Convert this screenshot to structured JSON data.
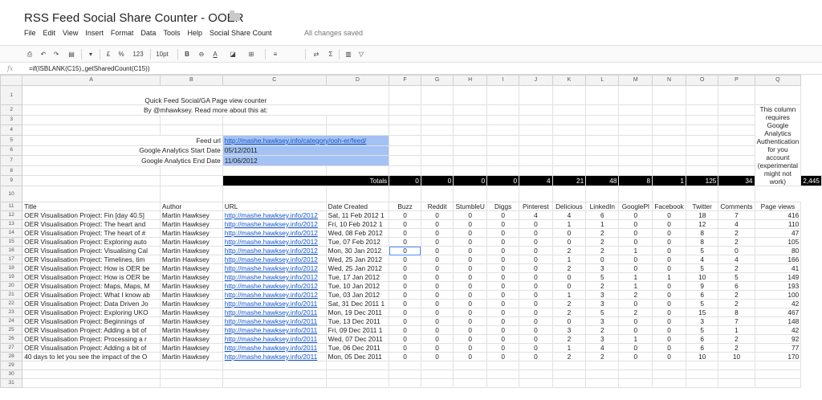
{
  "app": {
    "title": "RSS Feed Social Share Counter - OOER",
    "save_status": "All changes saved",
    "menu": [
      "File",
      "Edit",
      "View",
      "Insert",
      "Format",
      "Data",
      "Tools",
      "Help",
      "Social Share Count"
    ]
  },
  "toolbar": {
    "zoom_label": "%",
    "number_format": "123",
    "font_size": "10pt",
    "bold": "B",
    "text_color": "A",
    "sum": "Σ"
  },
  "formula_bar": {
    "fx": "fx",
    "formula": "=if(ISBLANK(C15),,getSharedCount(C15))"
  },
  "columns": [
    "A",
    "B",
    "C",
    "D",
    "F",
    "G",
    "H",
    "I",
    "J",
    "K",
    "L",
    "M",
    "N",
    "O",
    "P",
    "Q"
  ],
  "row_numbers": [
    "1",
    "2",
    "3",
    "4",
    "5",
    "6",
    "7",
    "8",
    "9",
    "10",
    "11",
    "12",
    "13",
    "14",
    "15",
    "16",
    "17",
    "18",
    "19",
    "20",
    "21",
    "22",
    "23",
    "24",
    "25",
    "26",
    "27",
    "28",
    "29",
    "30",
    "31"
  ],
  "sheet": {
    "main_title": "Quick Feed Social/GA Page view counter",
    "subtitle": "By @mhawksey. Read more about this at:",
    "note": "This column requires Google Analytics Authentication for you account (experimental might not work)",
    "feed_url_label": "Feed url",
    "feed_url": "http://mashe.hawksey.info/category/ooh-er/feed/",
    "ga_start_label": "Google Analytics Start Date",
    "ga_start": "05/12/2011",
    "ga_end_label": "Google Analytics End Date",
    "ga_end": "11/06/2012",
    "totals_label": "Totals",
    "totals": [
      "0",
      "0",
      "0",
      "0",
      "4",
      "21",
      "48",
      "8",
      "1",
      "125",
      "34",
      "2,445"
    ],
    "headers": [
      "Title",
      "Author",
      "URL",
      "Date Created",
      "Buzz",
      "Reddit",
      "StumbleU",
      "Diggs",
      "Pinterest",
      "Delicious",
      "LinkedIn",
      "GooglePl",
      "Facebook",
      "Twitter",
      "Comments",
      "Page views"
    ],
    "rows": [
      [
        "OER Visualisation Project: Fin [day 40.5]",
        "Martin Hawksey",
        "http://mashe.hawksey.info/2012",
        "Sat, 11 Feb 2012 1",
        "0",
        "0",
        "0",
        "0",
        "4",
        "4",
        "6",
        "0",
        "0",
        "18",
        "7",
        "416"
      ],
      [
        "OER Visualisation Project: The heart and",
        "Martin Hawksey",
        "http://mashe.hawksey.info/2012",
        "Fri, 10 Feb 2012 1",
        "0",
        "0",
        "0",
        "0",
        "0",
        "1",
        "1",
        "0",
        "0",
        "12",
        "4",
        "110"
      ],
      [
        "OER Visualisation Project: The heart of #",
        "Martin Hawksey",
        "http://mashe.hawksey.info/2012",
        "Wed, 08 Feb 2012",
        "0",
        "0",
        "0",
        "0",
        "0",
        "0",
        "2",
        "0",
        "0",
        "8",
        "2",
        "47"
      ],
      [
        "OER Visualisation Project: Exploring auto",
        "Martin Hawksey",
        "http://mashe.hawksey.info/2012",
        "Tue, 07 Feb 2012",
        "0",
        "0",
        "0",
        "0",
        "0",
        "0",
        "2",
        "0",
        "0",
        "8",
        "2",
        "105"
      ],
      [
        "OER Visualisation Project: Visualising Cal",
        "Martin Hawksey",
        "http://mashe.hawksey.info/2012",
        "Mon, 30 Jan 2012",
        "0",
        "0",
        "0",
        "0",
        "0",
        "2",
        "2",
        "1",
        "0",
        "5",
        "0",
        "80"
      ],
      [
        "OER Visualisation Project: Timelines, tim",
        "Martin Hawksey",
        "http://mashe.hawksey.info/2012",
        "Wed, 25 Jan 2012",
        "0",
        "0",
        "0",
        "0",
        "0",
        "1",
        "0",
        "0",
        "0",
        "4",
        "4",
        "166"
      ],
      [
        "OER Visualisation Project: How is OER be",
        "Martin Hawksey",
        "http://mashe.hawksey.info/2012",
        "Wed, 25 Jan 2012",
        "0",
        "0",
        "0",
        "0",
        "0",
        "2",
        "3",
        "0",
        "0",
        "5",
        "2",
        "41"
      ],
      [
        "OER Visualisation Project: How is OER be",
        "Martin Hawksey",
        "http://mashe.hawksey.info/2012",
        "Tue, 17 Jan 2012",
        "0",
        "0",
        "0",
        "0",
        "0",
        "0",
        "5",
        "1",
        "1",
        "10",
        "5",
        "149"
      ],
      [
        "OER Visualisation Project: Maps, Maps, M",
        "Martin Hawksey",
        "http://mashe.hawksey.info/2012",
        "Tue, 10 Jan 2012",
        "0",
        "0",
        "0",
        "0",
        "0",
        "0",
        "2",
        "1",
        "0",
        "9",
        "6",
        "193"
      ],
      [
        "OER Visualisation Project: What I know ab",
        "Martin Hawksey",
        "http://mashe.hawksey.info/2012",
        "Tue, 03 Jan 2012",
        "0",
        "0",
        "0",
        "0",
        "0",
        "1",
        "3",
        "2",
        "0",
        "6",
        "2",
        "100"
      ],
      [
        "OER Visualisation Project: Data Driven Jo",
        "Martin Hawksey",
        "http://mashe.hawksey.info/2011",
        "Sat, 31 Dec 2011 1",
        "0",
        "0",
        "0",
        "0",
        "0",
        "2",
        "3",
        "0",
        "0",
        "5",
        "2",
        "42"
      ],
      [
        "OER Visualisation Project: Exploring UKO",
        "Martin Hawksey",
        "http://mashe.hawksey.info/2011",
        "Mon, 19 Dec 2011",
        "0",
        "0",
        "0",
        "0",
        "0",
        "2",
        "5",
        "2",
        "0",
        "15",
        "8",
        "467"
      ],
      [
        "OER Visualisation Project: Beginnings of",
        "Martin Hawksey",
        "http://mashe.hawksey.info/2011",
        "Tue, 13 Dec 2011",
        "0",
        "0",
        "0",
        "0",
        "0",
        "0",
        "3",
        "0",
        "0",
        "3",
        "7",
        "148"
      ],
      [
        "OER Visualisation Project: Adding a bit of",
        "Martin Hawksey",
        "http://mashe.hawksey.info/2011",
        "Fri, 09 Dec 2011 1",
        "0",
        "0",
        "0",
        "0",
        "0",
        "3",
        "2",
        "0",
        "0",
        "5",
        "1",
        "42"
      ],
      [
        "OER Visualisation Project: Processing a r",
        "Martin Hawksey",
        "http://mashe.hawksey.info/2011",
        "Wed, 07 Dec 2011",
        "0",
        "0",
        "0",
        "0",
        "0",
        "2",
        "3",
        "1",
        "0",
        "6",
        "2",
        "92"
      ],
      [
        "OER Visualisation Project: Adding a bit of",
        "Martin Hawksey",
        "http://mashe.hawksey.info/2011",
        "Tue, 06 Dec 2011",
        "0",
        "0",
        "0",
        "0",
        "0",
        "1",
        "4",
        "0",
        "0",
        "6",
        "2",
        "77"
      ],
      [
        "40 days to let you see the impact of the O",
        "Martin Hawksey",
        "http://mashe.hawksey.info/2011",
        "Mon, 05 Dec 2011",
        "0",
        "0",
        "0",
        "0",
        "0",
        "2",
        "2",
        "0",
        "0",
        "10",
        "10",
        "170"
      ]
    ]
  }
}
